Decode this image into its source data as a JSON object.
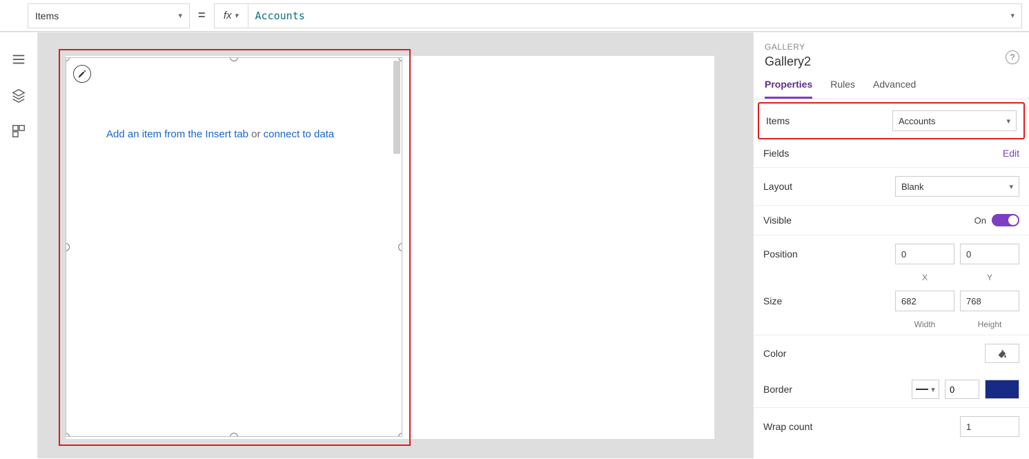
{
  "formulaBar": {
    "property": "Items",
    "fx": "fx",
    "formula": "Accounts"
  },
  "canvas": {
    "hint_prefix": "Add an item from the Insert tab",
    "hint_or": " or ",
    "hint_link": "connect to data"
  },
  "panel": {
    "type": "GALLERY",
    "name": "Gallery2",
    "tabs": {
      "properties": "Properties",
      "rules": "Rules",
      "advanced": "Advanced"
    },
    "items": {
      "label": "Items",
      "value": "Accounts"
    },
    "fields": {
      "label": "Fields",
      "edit": "Edit"
    },
    "layout": {
      "label": "Layout",
      "value": "Blank"
    },
    "visible": {
      "label": "Visible",
      "on": "On"
    },
    "position": {
      "label": "Position",
      "x": "0",
      "y": "0",
      "xlabel": "X",
      "ylabel": "Y"
    },
    "size": {
      "label": "Size",
      "w": "682",
      "h": "768",
      "wlabel": "Width",
      "hlabel": "Height"
    },
    "color": {
      "label": "Color"
    },
    "border": {
      "label": "Border",
      "width": "0"
    },
    "wrap": {
      "label": "Wrap count",
      "value": "1"
    }
  }
}
